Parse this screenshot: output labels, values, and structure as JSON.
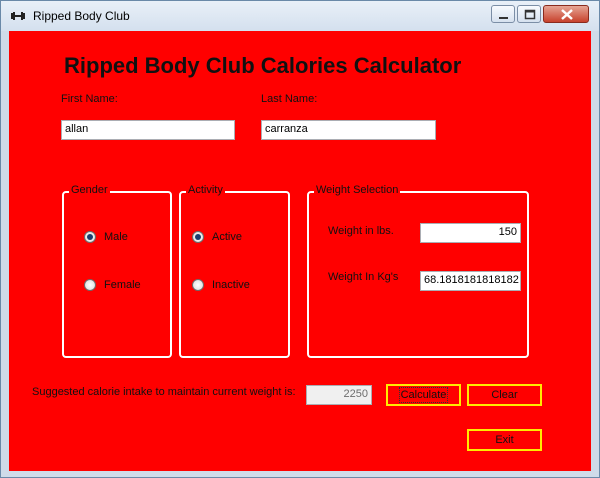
{
  "window": {
    "title": "Ripped Body Club"
  },
  "heading": "Ripped Body Club Calories Calculator",
  "name": {
    "first_label": "First Name:",
    "first_value": "allan",
    "last_label": "Last Name:",
    "last_value": "carranza"
  },
  "gender": {
    "title": "Gender",
    "options": [
      "Male",
      "Female"
    ],
    "selected": "Male"
  },
  "activity": {
    "title": "Activity",
    "options": [
      "Active",
      "Inactive"
    ],
    "selected": "Active"
  },
  "weight": {
    "title": "Weight Selection",
    "lbs_label": "Weight in lbs.",
    "lbs_value": "150",
    "kg_label": "Weight In Kg's",
    "kg_value": "68.1818181818182"
  },
  "result": {
    "label": "Suggested calorie intake to maintain current weight is:",
    "value": "2250"
  },
  "buttons": {
    "calculate": "Calculate",
    "clear": "Clear",
    "exit": "Exit"
  },
  "colors": {
    "form_background": "#ff0000",
    "button_border": "#ffeb00"
  }
}
